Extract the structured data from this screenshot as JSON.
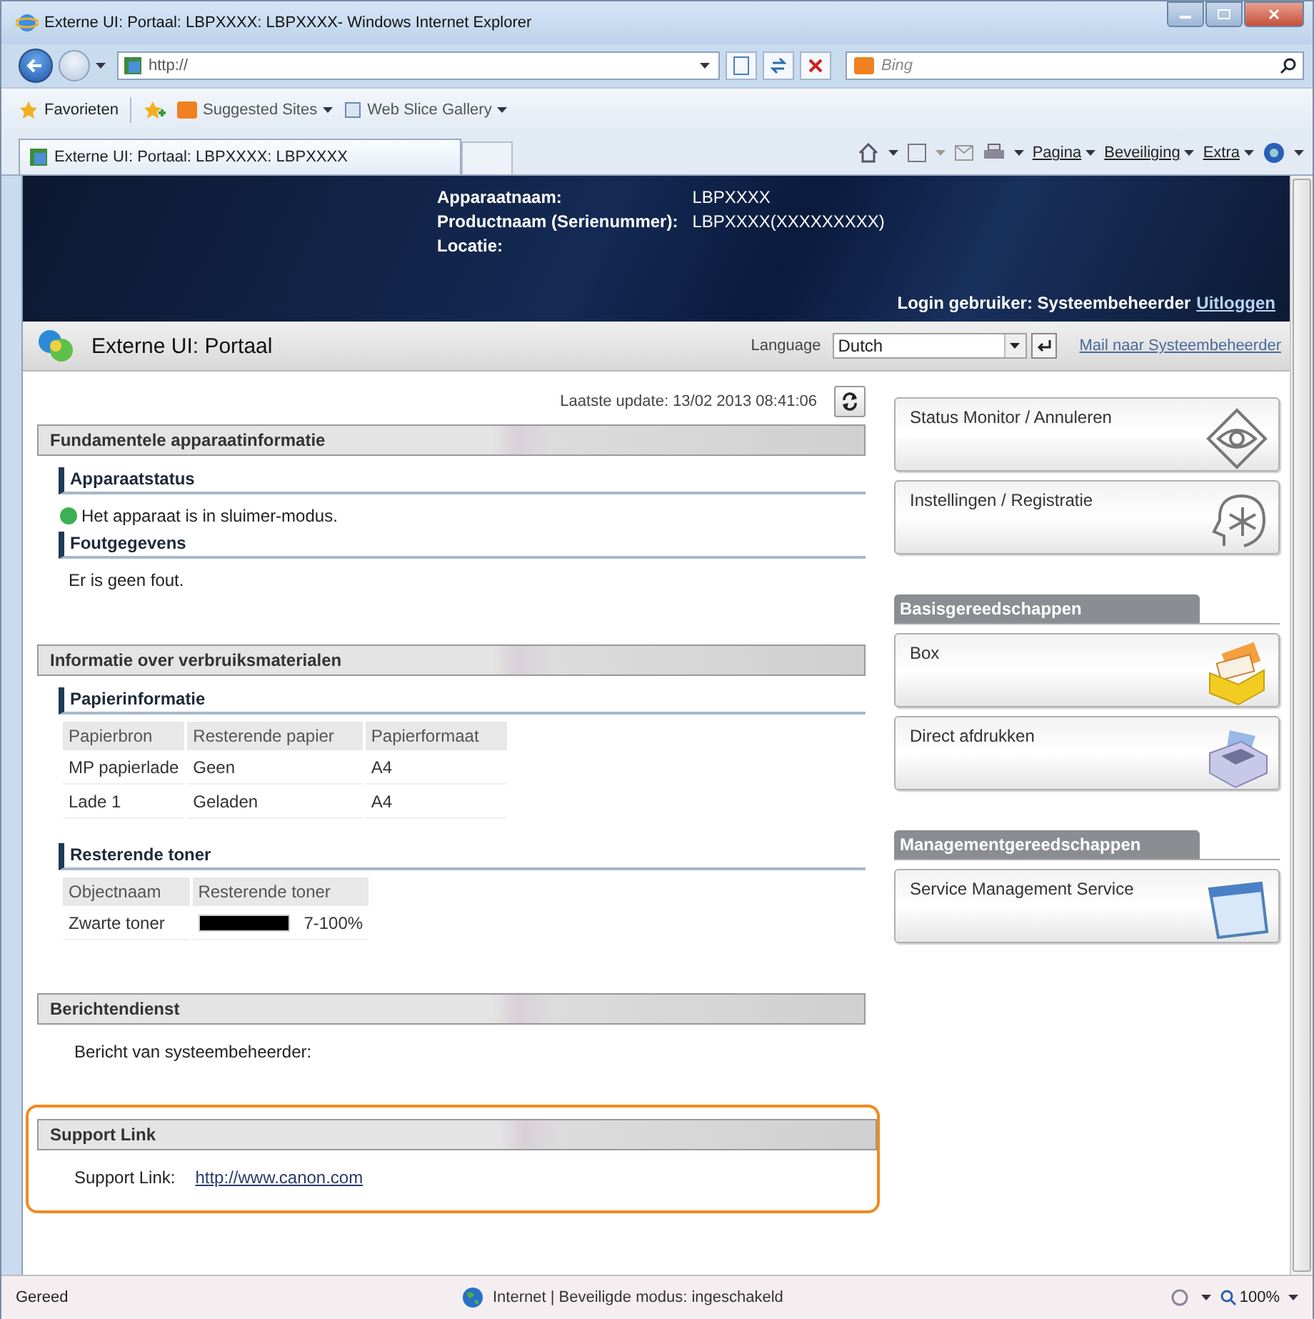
{
  "window": {
    "title": "Externe UI: Portaal: LBPXXXX: LBPXXXX- Windows Internet Explorer"
  },
  "address_bar": {
    "value": "http://"
  },
  "search": {
    "placeholder": "Bing"
  },
  "favorites_bar": {
    "label": "Favorieten",
    "items": [
      "Suggested Sites",
      "Web Slice Gallery"
    ]
  },
  "tab": {
    "title": "Externe UI: Portaal: LBPXXXX: LBPXXXX"
  },
  "command_bar": [
    "Pagina",
    "Beveiliging",
    "Extra"
  ],
  "header": {
    "fields": [
      {
        "label": "Apparaatnaam:",
        "value": "LBPXXXX"
      },
      {
        "label": "Productnaam (Serienummer):",
        "value": "LBPXXXX(XXXXXXXXX)"
      },
      {
        "label": "Locatie:"
      }
    ],
    "login_label": "Login gebruiker: Systeembeheerder",
    "logout_link": "Uitloggen"
  },
  "portal_bar": {
    "title": "Externe UI: Portaal",
    "language_label": "Language",
    "language": "Dutch",
    "mail_link": "Mail naar Systeembeheerder"
  },
  "last_update": "Laatste update: 13/02 2013 08:41:06",
  "sections": [
    {
      "title": "Fundamentele apparaatinformatie",
      "highlighted": false,
      "blocks": [
        {
          "kind": "status",
          "title": "Apparaatstatus",
          "text": "Het apparaat is in sluimer-modus.",
          "color": "#3cb054"
        },
        {
          "kind": "text",
          "title": "Foutgegevens",
          "text": "Er is geen fout."
        }
      ]
    },
    {
      "title": "Informatie over verbruiksmaterialen",
      "highlighted": false,
      "blocks": [
        {
          "kind": "table",
          "title": "Papierinformatie",
          "columns": [
            "Papierbron",
            "Resterende papier",
            "Papierformaat"
          ],
          "rows": [
            [
              "MP papierlade",
              "Geen",
              "A4"
            ],
            [
              "Lade 1",
              "Geladen",
              "A4"
            ]
          ]
        },
        {
          "kind": "toner",
          "title": "Resterende toner",
          "columns": [
            "Objectnaam",
            "Resterende toner"
          ],
          "rows": [
            {
              "name": "Zwarte toner",
              "level": 1,
              "reading": "7-100%"
            }
          ]
        }
      ]
    },
    {
      "title": "Berichtendienst",
      "highlighted": false,
      "blocks": [
        {
          "kind": "plain",
          "text": "Bericht van systeembeheerder:"
        }
      ]
    },
    {
      "title": "Support Link",
      "highlighted": true,
      "blocks": [
        {
          "kind": "link",
          "label": "Support Link:",
          "url": "http://www.canon.com"
        }
      ]
    }
  ],
  "right_panel": [
    {
      "kind": "tile",
      "label": "Status Monitor / Annuleren"
    },
    {
      "kind": "tile",
      "label": "Instellingen / Registratie"
    },
    {
      "kind": "heading",
      "label": "Basisgereedschappen"
    },
    {
      "kind": "tile",
      "label": "Box"
    },
    {
      "kind": "tile",
      "label": "Direct afdrukken"
    },
    {
      "kind": "heading",
      "label": "Managementgereedschappen"
    },
    {
      "kind": "tile",
      "label": "Service Management Service"
    }
  ],
  "status_bar": {
    "text": "Gereed",
    "zone": "Internet | Beveiligde modus: ingeschakeld",
    "zoom": "100%"
  }
}
